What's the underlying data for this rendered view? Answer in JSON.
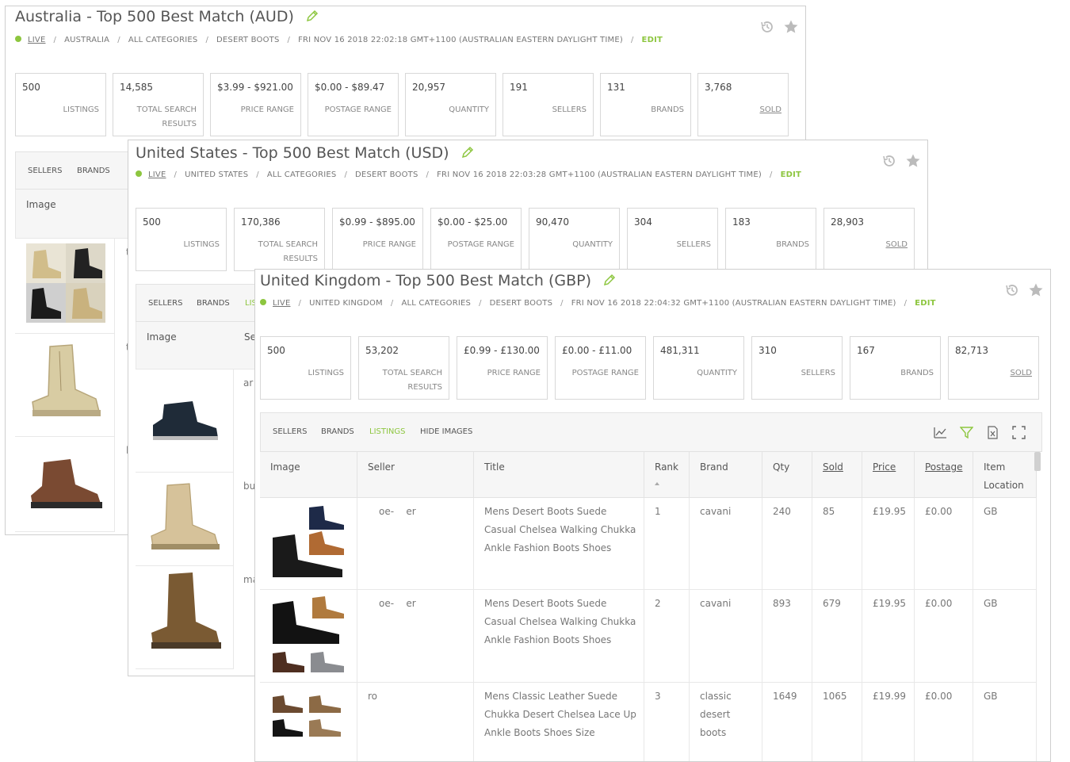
{
  "colors": {
    "accent": "#8dc63f",
    "border": "#cfcfcf",
    "text": "#555555"
  },
  "panels": {
    "au": {
      "title": "Australia - Top 500 Best Match (AUD)",
      "breadcrumb": {
        "live": "LIVE",
        "country": "AUSTRALIA",
        "category": "ALL CATEGORIES",
        "keyword": "DESERT BOOTS",
        "date": "FRI NOV 16 2018 22:02:18 GMT+1100 (AUSTRALIAN EASTERN DAYLIGHT TIME)",
        "edit": "EDIT"
      },
      "stats": [
        {
          "value": "500",
          "label": "LISTINGS"
        },
        {
          "value": "14,585",
          "label": "TOTAL SEARCH RESULTS"
        },
        {
          "value": "$3.99 - $921.00",
          "label": "PRICE RANGE"
        },
        {
          "value": "$0.00 - $89.47",
          "label": "POSTAGE RANGE"
        },
        {
          "value": "20,957",
          "label": "QUANTITY"
        },
        {
          "value": "191",
          "label": "SELLERS"
        },
        {
          "value": "131",
          "label": "BRANDS"
        },
        {
          "value": "3,768",
          "label": "SOLD"
        }
      ],
      "tabs": {
        "sellers": "SELLERS",
        "brands": "BRANDS"
      },
      "col_image": "Image",
      "row_texts": [
        "t",
        "t",
        "l"
      ]
    },
    "us": {
      "title": "United States - Top 500 Best Match (USD)",
      "breadcrumb": {
        "live": "LIVE",
        "country": "UNITED STATES",
        "category": "ALL CATEGORIES",
        "keyword": "DESERT BOOTS",
        "date": "FRI NOV 16 2018 22:03:28 GMT+1100 (AUSTRALIAN EASTERN DAYLIGHT TIME)",
        "edit": "EDIT"
      },
      "stats": [
        {
          "value": "500",
          "label": "LISTINGS"
        },
        {
          "value": "170,386",
          "label": "TOTAL SEARCH RESULTS"
        },
        {
          "value": "$0.99 - $895.00",
          "label": "PRICE RANGE"
        },
        {
          "value": "$0.00 - $25.00",
          "label": "POSTAGE RANGE"
        },
        {
          "value": "90,470",
          "label": "QUANTITY"
        },
        {
          "value": "304",
          "label": "SELLERS"
        },
        {
          "value": "183",
          "label": "BRANDS"
        },
        {
          "value": "28,903",
          "label": "SOLD"
        }
      ],
      "tabs": {
        "sellers": "SELLERS",
        "brands": "BRANDS",
        "listings": "LIS"
      },
      "col_image": "Image",
      "col_seller": "Se",
      "row_texts": [
        "ar",
        "bu",
        "ma"
      ]
    },
    "uk": {
      "title": "United Kingdom - Top 500 Best Match (GBP)",
      "breadcrumb": {
        "live": "LIVE",
        "country": "UNITED KINGDOM",
        "category": "ALL CATEGORIES",
        "keyword": "DESERT BOOTS",
        "date": "FRI NOV 16 2018 22:04:32 GMT+1100 (AUSTRALIAN EASTERN DAYLIGHT TIME)",
        "edit": "EDIT"
      },
      "stats": [
        {
          "value": "500",
          "label": "LISTINGS"
        },
        {
          "value": "53,202",
          "label": "TOTAL SEARCH RESULTS"
        },
        {
          "value": "£0.99 - £130.00",
          "label": "PRICE RANGE"
        },
        {
          "value": "£0.00 - £11.00",
          "label": "POSTAGE RANGE"
        },
        {
          "value": "481,311",
          "label": "QUANTITY"
        },
        {
          "value": "310",
          "label": "SELLERS"
        },
        {
          "value": "167",
          "label": "BRANDS"
        },
        {
          "value": "82,713",
          "label": "SOLD"
        }
      ],
      "tabs": {
        "sellers": "SELLERS",
        "brands": "BRANDS",
        "listings": "LISTINGS",
        "hide_images": "HIDE IMAGES"
      },
      "columns": [
        "Image",
        "Seller",
        "Title",
        "Rank",
        "Brand",
        "Qty",
        "Sold",
        "Price",
        "Postage",
        "Item Location"
      ],
      "rows": [
        {
          "seller": "oe-    er",
          "title": "Mens Desert Boots Suede\nCasual Chelsea Walking Chukka\nAnkle Fashion Boots Shoes",
          "rank": "1",
          "brand": "cavani",
          "qty": "240",
          "sold": "85",
          "price": "£19.95",
          "postage": "£0.00",
          "location": "GB"
        },
        {
          "seller": "oe-    er",
          "title": "Mens Desert Boots Suede\nCasual Chelsea Walking Chukka\nAnkle Fashion Boots Shoes",
          "rank": "2",
          "brand": "cavani",
          "qty": "893",
          "sold": "679",
          "price": "£19.95",
          "postage": "£0.00",
          "location": "GB"
        },
        {
          "seller": "ro",
          "title": "Mens Classic Leather Suede\nChukka Desert Chelsea Lace Up\nAnkle Boots Shoes Size",
          "rank": "3",
          "brand": "classic\ndesert\nboots",
          "qty": "1649",
          "sold": "1065",
          "price": "£19.99",
          "postage": "£0.00",
          "location": "GB"
        }
      ]
    }
  }
}
